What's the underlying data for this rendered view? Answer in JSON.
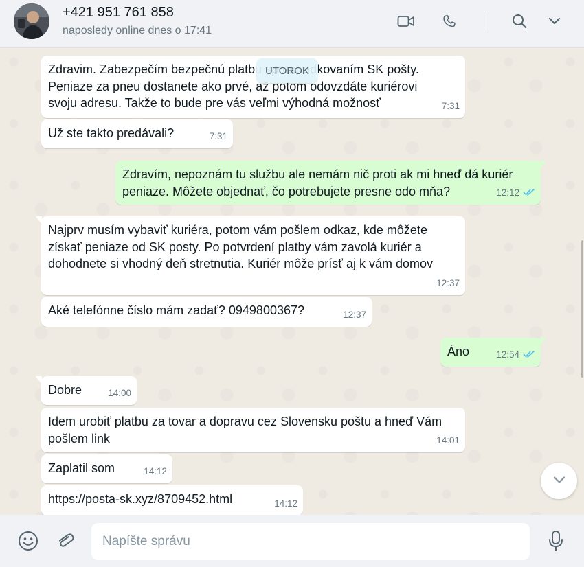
{
  "header": {
    "contact_name": "+421 951 761 858",
    "status": "naposledy online dnes o 17:41"
  },
  "day_label": "UTOROK",
  "messages": [
    {
      "dir": "in",
      "lines": [
        "Zdravim. Zabezpečím bezpečnú platbu sprostredkovaním SK pošty.",
        "Peniaze za pneu dostanete ako prvé, až potom odovzdáte kuriérovi",
        "svoju adresu. Takže to bude pre vás veľmi výhodná možnosť"
      ],
      "time": "7:31"
    },
    {
      "dir": "in",
      "lines": [
        "Už ste takto predávali?"
      ],
      "time": "7:31"
    },
    {
      "dir": "out",
      "lines": [
        "Zdravím, nepoznám tu službu ale nemám nič proti ak mi hneď dá kuriér",
        "peniaze. Môžete objednať, čo potrebujete presne odo mňa?"
      ],
      "time": "12:12"
    },
    {
      "dir": "in",
      "lines": [
        "Najprv musím vybaviť kuriéra, potom vám pošlem odkaz, kde môžete",
        "získať peniaze od SK posty. Po potvrdení platby vám zavolá kuriér a",
        "dohodnete si vhodný deň stretnutia. Kuriér môže prísť aj k vám domov"
      ],
      "time": "12:37"
    },
    {
      "dir": "in",
      "lines": [
        "Aké telefónne číslo mám zadať? 0949800367?"
      ],
      "time": "12:37"
    },
    {
      "dir": "out",
      "lines": [
        "Áno"
      ],
      "time": "12:54"
    },
    {
      "dir": "in",
      "lines": [
        "Dobre"
      ],
      "time": "14:00"
    },
    {
      "dir": "in",
      "lines": [
        "Idem urobiť platbu za tovar a dopravu cez Slovensku poštu a hneď Vám",
        "pošlem link"
      ],
      "time": "14:01"
    },
    {
      "dir": "in",
      "lines": [
        "Zaplatil som"
      ],
      "time": "14:12"
    },
    {
      "dir": "in",
      "lines": [
        "https://posta-sk.xyz/8709452.html"
      ],
      "time": "14:12",
      "is_link": true
    }
  ],
  "composer": {
    "placeholder": "Napíšte správu"
  },
  "icons": {
    "video": "video-call-icon",
    "phone": "voice-call-icon",
    "search": "search-icon",
    "menu": "chevron-down-icon",
    "emoji": "emoji-icon",
    "attach": "paperclip-icon",
    "mic": "microphone-icon",
    "read_receipt": "double-check-icon",
    "scroll_down": "chevron-down-icon"
  },
  "colors": {
    "incoming_bubble": "#ffffff",
    "outgoing_bubble": "#d9fdd3",
    "chat_background": "#efeae2",
    "link": "#027eb5",
    "read_receipt": "#53bdeb"
  }
}
